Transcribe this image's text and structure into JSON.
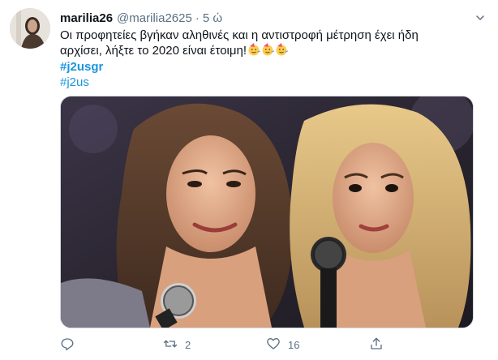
{
  "tweet": {
    "display_name": "marilia26",
    "handle": "@marilia2625",
    "separator": "·",
    "time": "5 ώ",
    "text_line1": "Οι προφητείες βγήκαν  αληθινές και η αντιστροφή μέτρηση έχει ήδη",
    "text_line2": "αρχίσει,  λήξτε το 2020 είναι έτοιμη!",
    "emojis": [
      "party-face-emoji",
      "party-face-emoji",
      "party-face-emoji"
    ],
    "hashtags": [
      "#j2usgr",
      "#j2us"
    ]
  },
  "actions": {
    "reply_count": "",
    "retweet_count": "2",
    "like_count": "16"
  },
  "icons": {
    "caret": "chevron-down-icon",
    "reply": "reply-icon",
    "retweet": "retweet-icon",
    "like": "heart-icon",
    "share": "share-icon"
  },
  "colors": {
    "link": "#1b95e0",
    "secondary_text": "#5b7083",
    "primary_text": "#0f1419"
  }
}
